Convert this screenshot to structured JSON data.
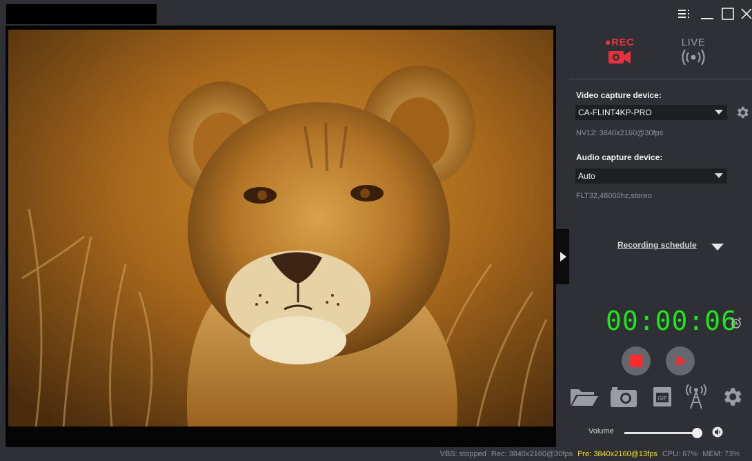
{
  "titlebar": {
    "title": "",
    "icons": [
      "menu-icon",
      "minimize-icon",
      "maximize-icon",
      "close-icon"
    ]
  },
  "modes": {
    "rec_label": "●REC",
    "live_label": "LIVE",
    "rec_color": "#e8333f",
    "live_color": "#9a9ca2"
  },
  "video": {
    "label": "Video capture device:",
    "selected": "CA-FLINT4KP-PRO",
    "format": "NV12: 3840x2160@30fps"
  },
  "audio": {
    "label": "Audio capture device:",
    "selected": "Auto",
    "format": "FLT32,48000hz,stereo"
  },
  "schedule": {
    "label": "Recording schedule"
  },
  "timer": {
    "value": "00:00:06",
    "color": "#22e41d"
  },
  "controls": {
    "stop_color": "#ff2a2a",
    "play_color": "#ff2a2a"
  },
  "tools": [
    "folder-icon",
    "camera-icon",
    "gif-icon",
    "antenna-icon",
    "gear-icon"
  ],
  "volume": {
    "label": "Volume",
    "level_fraction": 0.95
  },
  "status": {
    "vbs": "VBS: stopped",
    "rec": "Rec: 3840x2160@30fps",
    "pre": "Pre: 3840x2160@13fps",
    "cpu": "CPU: 67%",
    "mem": "MEM: 73%",
    "pre_color": "#f4e01f"
  }
}
